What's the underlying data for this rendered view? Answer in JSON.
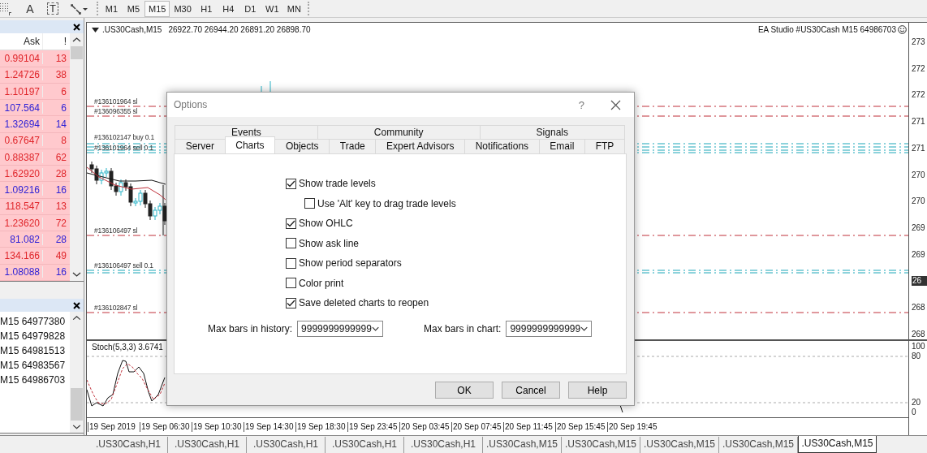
{
  "toolbar": {
    "text_tool": "A",
    "label_tool": "T",
    "timeframes": [
      {
        "label": "M1",
        "selected": false
      },
      {
        "label": "M5",
        "selected": false
      },
      {
        "label": "M15",
        "selected": true
      },
      {
        "label": "M30",
        "selected": false
      },
      {
        "label": "H1",
        "selected": false
      },
      {
        "label": "H4",
        "selected": false
      },
      {
        "label": "D1",
        "selected": false
      },
      {
        "label": "W1",
        "selected": false
      },
      {
        "label": "MN",
        "selected": false
      }
    ]
  },
  "market_watch": {
    "columns": [
      "Ask",
      "!"
    ],
    "rows": [
      {
        "ask": "0.99104",
        "spread": "13",
        "color": "#e0262b"
      },
      {
        "ask": "1.24726",
        "spread": "38",
        "color": "#e0262b"
      },
      {
        "ask": "1.10197",
        "spread": "6",
        "color": "#e0262b"
      },
      {
        "ask": "107.564",
        "spread": "6",
        "color": "#2b1fd6"
      },
      {
        "ask": "1.32694",
        "spread": "14",
        "color": "#2b1fd6"
      },
      {
        "ask": "0.67647",
        "spread": "8",
        "color": "#e0262b"
      },
      {
        "ask": "0.88387",
        "spread": "62",
        "color": "#e0262b"
      },
      {
        "ask": "1.62920",
        "spread": "28",
        "color": "#e0262b"
      },
      {
        "ask": "1.09216",
        "spread": "16",
        "color": "#2b1fd6"
      },
      {
        "ask": "118.547",
        "spread": "13",
        "color": "#e0262b"
      },
      {
        "ask": "1.23620",
        "spread": "72",
        "color": "#e0262b"
      },
      {
        "ask": "81.082",
        "spread": "28",
        "color": "#2b1fd6"
      },
      {
        "ask": "134.166",
        "spread": "49",
        "color": "#e0262b"
      },
      {
        "ask": "1.08088",
        "spread": "16",
        "color": "#2b1fd6"
      }
    ]
  },
  "navigator": {
    "items": [
      "M15 64977380",
      "M15 64979828",
      "M15 64981513",
      "M15 64983567",
      "M15 64986703"
    ]
  },
  "chart": {
    "symbol": ".US30Cash,M15",
    "ohlc": "26922.70 26944.20 26891.20 26898.70",
    "expert": "EA Studio #US30Cash M15 64986703",
    "trade_labels": [
      "#136101964 sl",
      "#136096355 sl",
      "#136102147 buy 0.1",
      "#136101964 sell 0.1",
      "#136106497 sl",
      "#136106497 sell 0.1",
      "#136102847 sl"
    ],
    "price_axis": [
      {
        "label": "273",
        "kind": "tick"
      },
      {
        "label": "272",
        "kind": "tick"
      },
      {
        "label": "272",
        "kind": "tick"
      },
      {
        "label": "271",
        "kind": "tick"
      },
      {
        "label": "271",
        "kind": "tick"
      },
      {
        "label": "270",
        "kind": "tick"
      },
      {
        "label": "270",
        "kind": "tick"
      },
      {
        "label": "269",
        "kind": "tick"
      },
      {
        "label": "269",
        "kind": "tick"
      },
      {
        "label": "26",
        "kind": "current"
      },
      {
        "label": "268",
        "kind": "tick"
      },
      {
        "label": "268",
        "kind": "tick"
      }
    ],
    "indicator": {
      "title": "Stoch(5,3,3) 3.6741",
      "axis": [
        "100",
        "80",
        "20",
        "0"
      ]
    },
    "time_axis": [
      "19 Sep 2019",
      "19 Sep 06:30",
      "19 Sep 10:30",
      "19 Sep 14:30",
      "19 Sep 18:30",
      "19 Sep 23:45",
      "20 Sep 03:45",
      "20 Sep 07:45",
      "20 Sep 11:45",
      "20 Sep 15:45",
      "20 Sep 19:45"
    ]
  },
  "dialog": {
    "title": "Options",
    "help": "?",
    "tab_rows": [
      [
        {
          "label": "Events",
          "selected": false
        },
        {
          "label": "Community",
          "selected": false
        },
        {
          "label": "Signals",
          "selected": false
        }
      ],
      [
        {
          "label": "Server",
          "selected": false
        },
        {
          "label": "Charts",
          "selected": true
        },
        {
          "label": "Objects",
          "selected": false
        },
        {
          "label": "Trade",
          "selected": false
        },
        {
          "label": "Expert Advisors",
          "selected": false
        },
        {
          "label": "Notifications",
          "selected": false
        },
        {
          "label": "Email",
          "selected": false
        },
        {
          "label": "FTP",
          "selected": false
        }
      ]
    ],
    "options": [
      {
        "label": "Show trade levels",
        "checked": true,
        "children": [
          {
            "label": "Use 'Alt' key to drag trade levels",
            "checked": false
          }
        ]
      },
      {
        "label": "Show OHLC",
        "checked": true
      },
      {
        "label": "Show ask line",
        "checked": false
      },
      {
        "label": "Show period separators",
        "checked": false
      },
      {
        "label": "Color print",
        "checked": false
      },
      {
        "label": "Save deleted charts to reopen",
        "checked": true
      }
    ],
    "fields": [
      {
        "label": "Max bars in history:",
        "value": "9999999999999"
      },
      {
        "label": "Max bars in chart:",
        "value": "9999999999999"
      }
    ],
    "buttons": [
      "OK",
      "Cancel",
      "Help"
    ]
  },
  "chart_tabs": [
    {
      "label": ".US30Cash,H1",
      "selected": false
    },
    {
      "label": ".US30Cash,H1",
      "selected": false
    },
    {
      "label": ".US30Cash,H1",
      "selected": false
    },
    {
      "label": ".US30Cash,H1",
      "selected": false
    },
    {
      "label": ".US30Cash,H1",
      "selected": false
    },
    {
      "label": ".US30Cash,M15",
      "selected": false
    },
    {
      "label": ".US30Cash,M15",
      "selected": false
    },
    {
      "label": ".US30Cash,M15",
      "selected": false
    },
    {
      "label": ".US30Cash,M15",
      "selected": false
    },
    {
      "label": ".US30Cash,M15",
      "selected": true
    }
  ]
}
